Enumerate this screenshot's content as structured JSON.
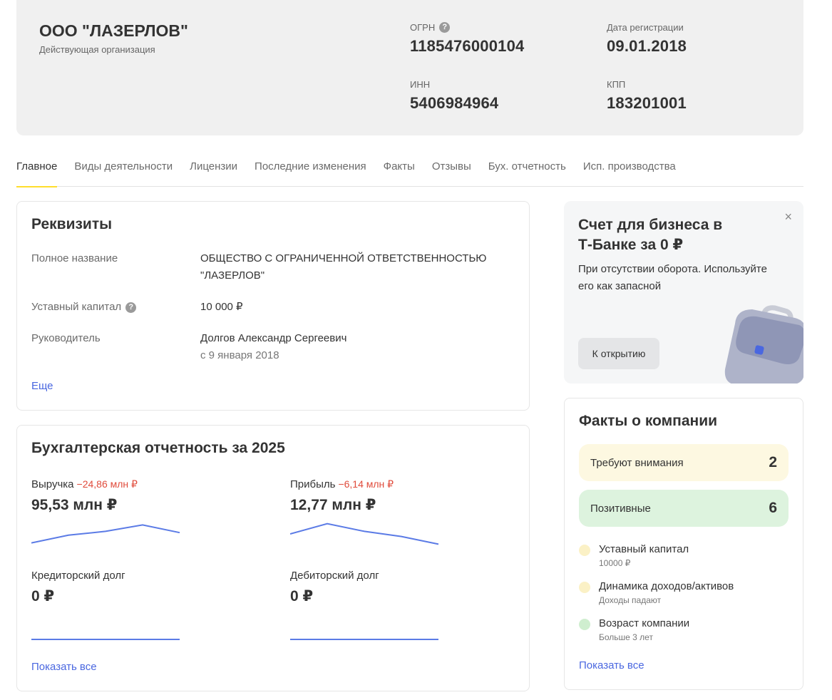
{
  "company": {
    "name": "ООО \"ЛАЗЕРЛОВ\"",
    "status": "Действующая организация",
    "fields": [
      {
        "label": "ОГРН",
        "value": "1185476000104"
      },
      {
        "label": "Дата регистрации",
        "value": "09.01.2018"
      },
      {
        "label": "ИНН",
        "value": "5406984964"
      },
      {
        "label": "КПП",
        "value": "183201001"
      }
    ]
  },
  "tabs": [
    {
      "label": "Главное",
      "active": true
    },
    {
      "label": "Виды деятельности"
    },
    {
      "label": "Лицензии"
    },
    {
      "label": "Последние изменения"
    },
    {
      "label": "Факты"
    },
    {
      "label": "Отзывы"
    },
    {
      "label": "Бух. отчетность"
    },
    {
      "label": "Исп. производства"
    }
  ],
  "requisites": {
    "title": "Реквизиты",
    "full_name_label": "Полное название",
    "full_name_value": "ОБЩЕСТВО С ОГРАНИЧЕННОЙ ОТВЕТСТВЕННОСТЬЮ \"ЛАЗЕРЛОВ\"",
    "capital_label": "Уставный капитал",
    "capital_value": "10 000 ₽",
    "head_label": "Руководитель",
    "head_value": "Долгов Александр Сергеевич",
    "head_since": "с 9 января 2018",
    "more_link": "Еще"
  },
  "accounting": {
    "title": "Бухгалтерская отчетность за 2025",
    "revenue": {
      "label": "Выручка",
      "change": "−24,86 млн ₽",
      "value": "95,53 млн ₽",
      "trend": [
        0.15,
        0.45,
        0.6,
        0.85,
        0.55
      ]
    },
    "profit": {
      "label": "Прибыль",
      "change": "−6,14 млн ₽",
      "value": "12,77 млн ₽",
      "trend": [
        0.5,
        0.9,
        0.6,
        0.4,
        0.1
      ]
    },
    "creditor": {
      "label": "Кредиторский долг",
      "value": "0 ₽",
      "trend": [
        0,
        0,
        0,
        0,
        0
      ]
    },
    "debtor": {
      "label": "Дебиторский долг",
      "value": "0 ₽",
      "trend": [
        0,
        0,
        0,
        0,
        0
      ]
    },
    "show_all": "Показать все"
  },
  "promo": {
    "title": "Счет для бизнеса в Т‑Банке за 0 ₽",
    "text": "При отсутствии оборота. Используйте его как запасной",
    "button": "К открытию",
    "close": "×"
  },
  "facts": {
    "title": "Факты о компании",
    "attention_label": "Требуют внимания",
    "attention_count": "2",
    "positive_label": "Позитивные",
    "positive_count": "6",
    "items": [
      {
        "label": "Уставный капитал",
        "sub": "10000 ₽",
        "status": "attention"
      },
      {
        "label": "Динамика доходов/активов",
        "sub": "Доходы падают",
        "status": "attention"
      },
      {
        "label": "Возраст компании",
        "sub": "Больше 3 лет",
        "status": "positive"
      }
    ],
    "show_all": "Показать все"
  },
  "colors": {
    "attention_bg": "#fdf8e1",
    "attention_dot": "#fbf1c6",
    "positive_bg": "#ddf3de",
    "positive_dot": "#cfeecf",
    "accent_link": "#4a67e0",
    "negative": "#e04b3b",
    "tab_underline": "#ffdd2d",
    "sparkline": "#5b7be6"
  }
}
